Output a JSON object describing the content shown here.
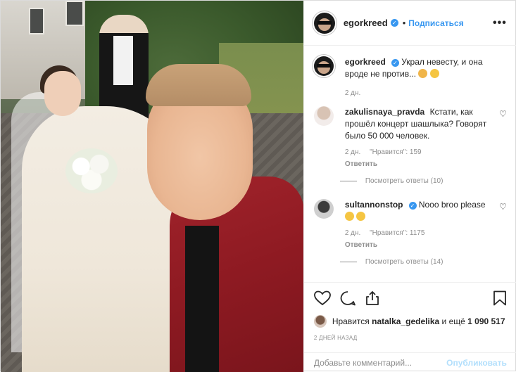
{
  "post": {
    "author": "egorkreed",
    "follow_label": "Подписаться",
    "more_label": "•••",
    "caption": {
      "username": "egorkreed",
      "text": "Украл невесту, и она вроде не против...",
      "time": "2 дн."
    },
    "comments": [
      {
        "username": "zakulisnaya_pravda",
        "text": "Кстати, как прошёл концерт шашлыка? Говорят было 50 000 человек.",
        "time": "2 дн.",
        "likes": "\"Нравится\": 159",
        "reply_label": "Ответить",
        "view_replies": "Посмотреть ответы (10)",
        "verified": false
      },
      {
        "username": "sultannonstop",
        "text": "Nooo broo please",
        "time": "2 дн.",
        "likes": "\"Нравится\": 1175",
        "reply_label": "Ответить",
        "view_replies": "Посмотреть ответы (14)",
        "verified": true
      }
    ],
    "likes_prefix": "Нравится",
    "liked_by_user": "natalka_gedelika",
    "likes_suffix": "и ещё",
    "likes_count": "1 090 517",
    "timestamp": "2 ДНЕЙ НАЗАД",
    "add_comment_placeholder": "Добавьте комментарий...",
    "publish_label": "Опубликовать"
  },
  "colors": {
    "accent": "#3897f0",
    "jacket": "#a1232b",
    "muted": "#8e8e8e"
  },
  "icons": {
    "like": "heart-outline-icon",
    "comment": "comment-bubble-icon",
    "share": "share-icon",
    "save": "bookmark-icon",
    "verified": "verified-badge-icon"
  }
}
